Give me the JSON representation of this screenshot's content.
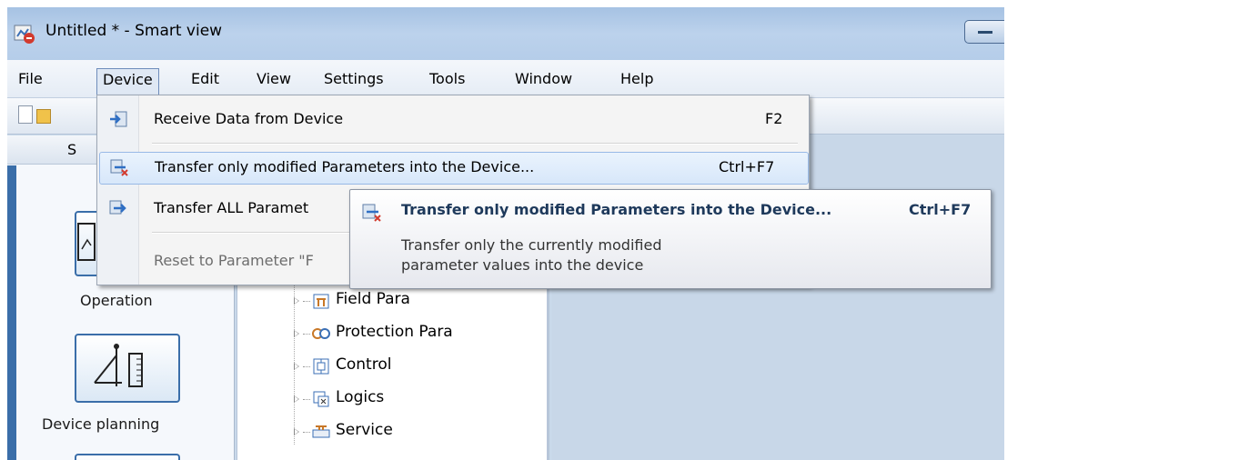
{
  "window": {
    "title": "Untitled * - Smart view"
  },
  "menubar": {
    "items": [
      "File",
      "Device",
      "Edit",
      "View",
      "Settings",
      "Tools",
      "Window",
      "Help"
    ]
  },
  "left_panel": {
    "header_label": "S",
    "buttons": [
      {
        "label": "Operation",
        "icon": "operation-icon"
      },
      {
        "label": "Device planning",
        "icon": "device-planning-icon"
      }
    ]
  },
  "tree": {
    "items": [
      {
        "label": "Field Para",
        "icon": "field-para-icon"
      },
      {
        "label": "Protection Para",
        "icon": "protection-para-icon"
      },
      {
        "label": "Control",
        "icon": "control-icon"
      },
      {
        "label": "Logics",
        "icon": "logics-icon"
      },
      {
        "label": "Service",
        "icon": "service-icon"
      }
    ]
  },
  "device_menu": {
    "items": [
      {
        "label": "Receive Data from Device",
        "shortcut": "F2",
        "icon": "receive-data-icon"
      },
      {
        "label": "Transfer only modified Parameters into the Device...",
        "shortcut": "Ctrl+F7",
        "icon": "transfer-modified-icon"
      },
      {
        "label": "Transfer ALL Paramet",
        "shortcut": "",
        "icon": "transfer-all-icon"
      },
      {
        "label": "Reset to Parameter \"F",
        "shortcut": "",
        "icon": ""
      }
    ]
  },
  "tooltip": {
    "title": "Transfer only modified Parameters into the Device...",
    "shortcut": "Ctrl+F7",
    "description_line1": "Transfer only the currently modified",
    "description_line2": "parameter values into the device"
  }
}
